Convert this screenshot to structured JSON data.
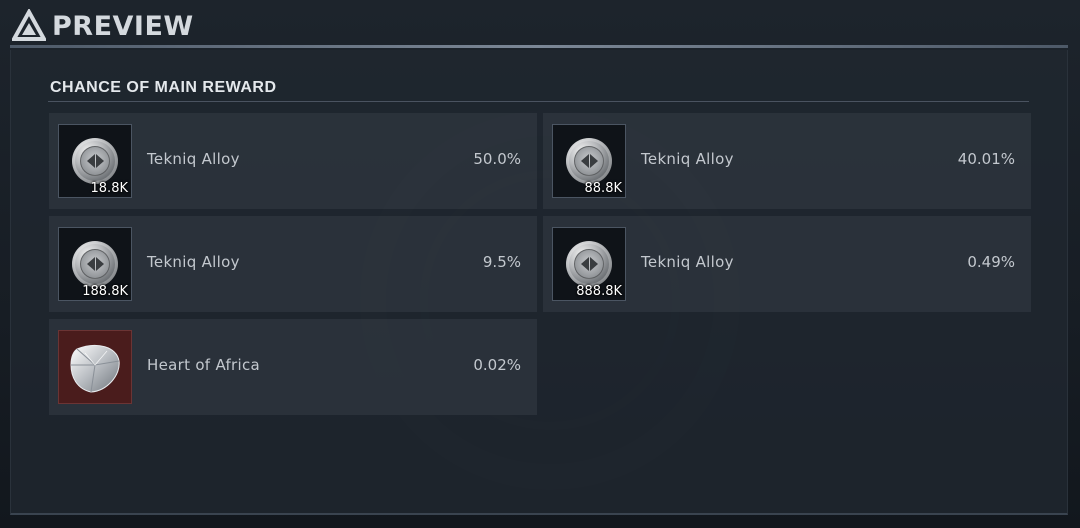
{
  "header": {
    "title": "PREVIEW",
    "icon": "triangle-logo-icon"
  },
  "section": {
    "title": "CHANCE OF MAIN REWARD"
  },
  "rewards": [
    {
      "name": "Tekniq Alloy",
      "quantity": "18.8K",
      "chance": "50.0%",
      "icon": "tekniq-alloy-coin-icon"
    },
    {
      "name": "Tekniq Alloy",
      "quantity": "88.8K",
      "chance": "40.01%",
      "icon": "tekniq-alloy-coin-icon"
    },
    {
      "name": "Tekniq Alloy",
      "quantity": "188.8K",
      "chance": "9.5%",
      "icon": "tekniq-alloy-coin-icon"
    },
    {
      "name": "Tekniq Alloy",
      "quantity": "888.8K",
      "chance": "0.49%",
      "icon": "tekniq-alloy-coin-icon"
    },
    {
      "name": "Heart of Africa",
      "quantity": "",
      "chance": "0.02%",
      "icon": "diamond-gem-icon"
    }
  ],
  "colors": {
    "accent_line": "#7b8796",
    "card_bg": "#343c46",
    "gem_frame": "#4a1c1c"
  }
}
